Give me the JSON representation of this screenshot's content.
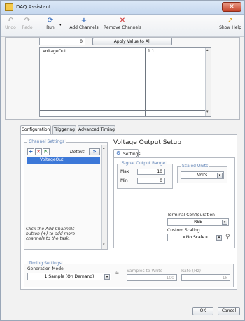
{
  "window": {
    "title": "DAQ Assistant",
    "close_glyph": "✕"
  },
  "toolbar": {
    "undo_label": "Undo",
    "redo_label": "Redo",
    "run_label": "Run",
    "add_channels_label": "Add Channels",
    "remove_channels_label": "Remove Channels",
    "show_help_label": "Show Help",
    "undo_icon": "undo-icon",
    "redo_icon": "redo-icon",
    "run_icon": "run-icon",
    "add_icon": "plus-icon",
    "remove_icon": "x-icon",
    "help_icon": "help-arrow-icon"
  },
  "apply": {
    "value": "0",
    "button_label": "Apply Value to All"
  },
  "channel_table": {
    "rows": [
      {
        "name": "VoltageOut",
        "value": "1.1"
      }
    ]
  },
  "tabs": [
    {
      "label": "Configuration",
      "active": true
    },
    {
      "label": "Triggering",
      "active": false
    },
    {
      "label": "Advanced Timing",
      "active": false
    }
  ],
  "channel_settings": {
    "group_label": "Channel Settings",
    "details_label": "Details",
    "selected_channel": "VoltageOut",
    "hint_text": "Click the Add Channels button (+) to add more channels to the task."
  },
  "voltage_setup": {
    "title": "Voltage Output Setup",
    "settings_tab": "Settings",
    "signal_range_label": "Signal Output Range",
    "max_label": "Max",
    "max_value": "10",
    "min_label": "Min",
    "min_value": "0",
    "scaled_units_label": "Scaled Units",
    "scaled_units_value": "Volts",
    "terminal_config_label": "Terminal Configuration",
    "terminal_config_value": "RSE",
    "custom_scaling_label": "Custom Scaling",
    "custom_scaling_value": "<No Scale>"
  },
  "timing": {
    "group_label": "Timing Settings",
    "generation_mode_label": "Generation Mode",
    "generation_mode_value": "1 Sample (On Demand)",
    "samples_label": "Samples to Write",
    "samples_value": "100",
    "rate_label": "Rate (Hz)",
    "rate_value": "1k"
  },
  "footer": {
    "ok_label": "OK",
    "cancel_label": "Cancel"
  }
}
